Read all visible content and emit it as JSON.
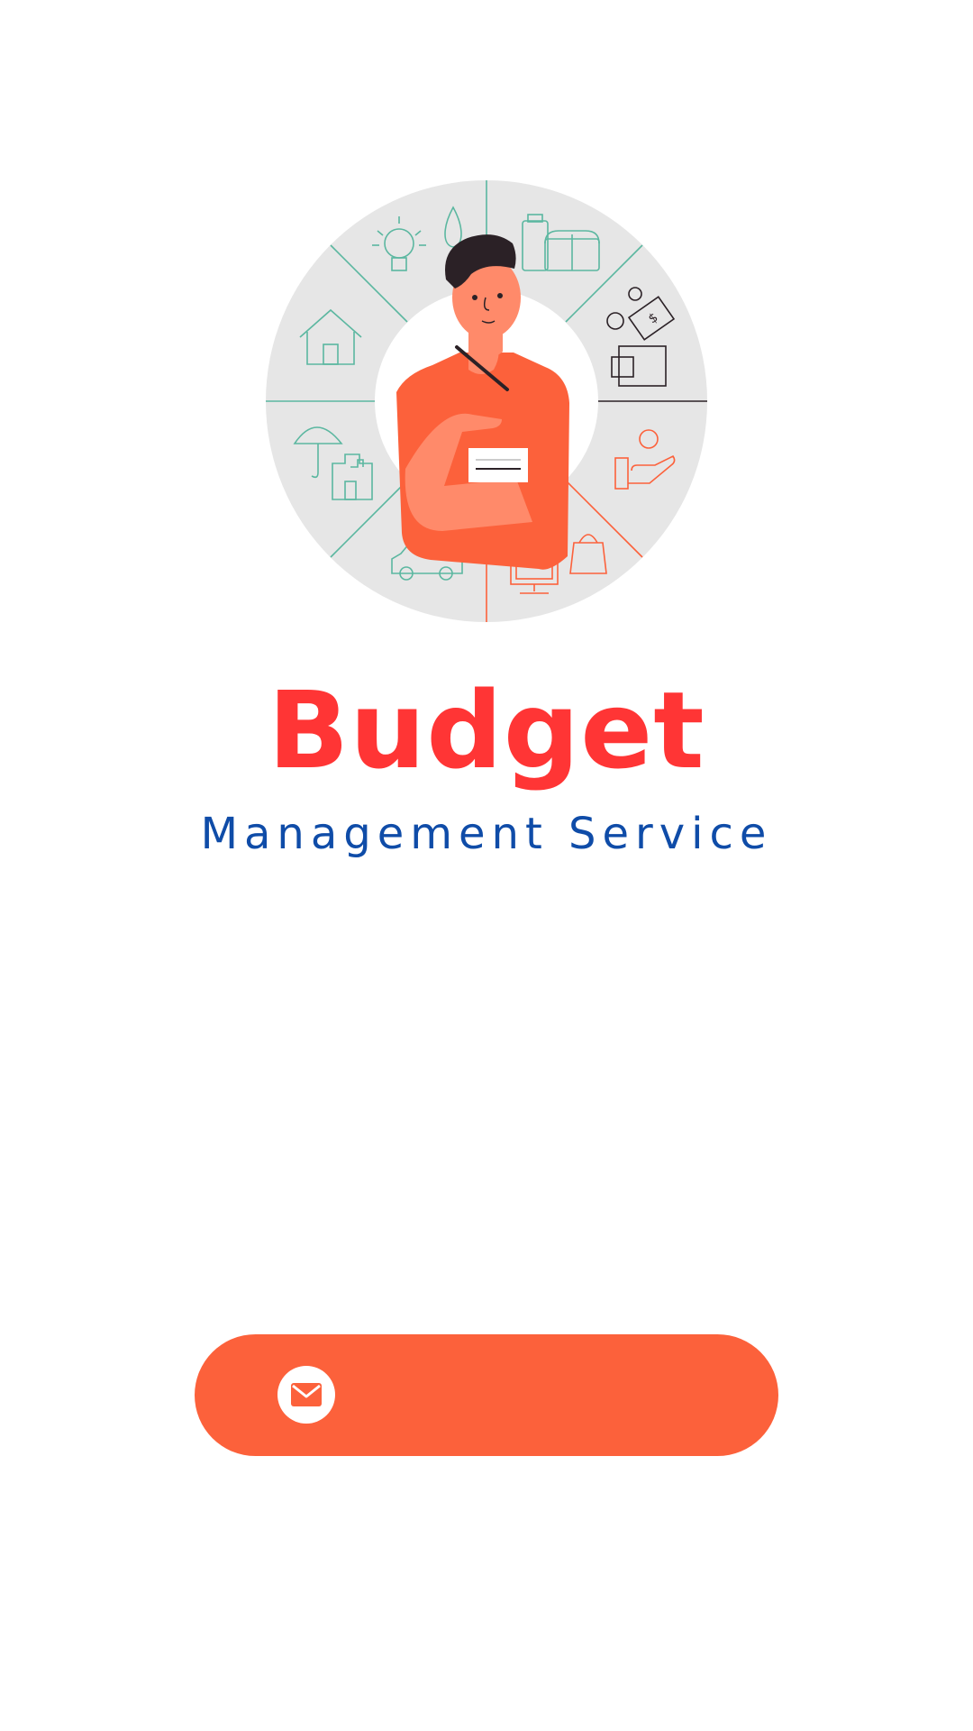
{
  "app": {
    "title": "Budget",
    "subtitle": "Management Service"
  },
  "hero": {
    "illustration": "budget-wheel-illustration"
  },
  "login": {
    "email_button_label": "",
    "email_icon": "mail-icon"
  },
  "colors": {
    "title": "#ff3535",
    "subtitle": "#0f4ca8",
    "accent": "#fc613b",
    "wheel_bg": "#e6e6e6",
    "teal_line": "#5bb7a0",
    "dark_line": "#2b2126"
  }
}
